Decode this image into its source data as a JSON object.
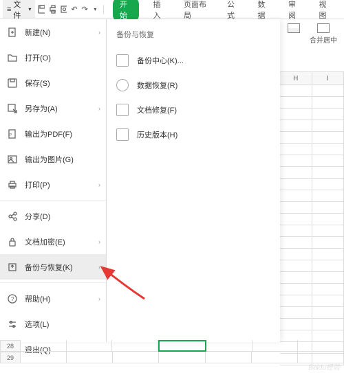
{
  "toolbar": {
    "file_label": "文件"
  },
  "tabs": {
    "start": "开始",
    "insert": "插入",
    "layout": "页面布局",
    "formula": "公式",
    "data": "数据",
    "review": "审阅",
    "view": "视图"
  },
  "ribbon": {
    "merge_center": "合并居中"
  },
  "file_menu": {
    "new": "新建(N)",
    "open": "打开(O)",
    "save": "保存(S)",
    "save_as": "另存为(A)",
    "export_pdf": "输出为PDF(F)",
    "export_img": "输出为图片(G)",
    "print": "打印(P)",
    "share": "分享(D)",
    "encrypt": "文档加密(E)",
    "backup": "备份与恢复(K)",
    "help": "帮助(H)",
    "options": "选项(L)",
    "exit": "退出(Q)"
  },
  "submenu": {
    "title": "备份与恢复",
    "items": {
      "backup_center": "备份中心(K)...",
      "data_recovery": "数据恢复(R)",
      "doc_repair": "文档修复(F)",
      "history": "历史版本(H)"
    }
  },
  "grid": {
    "col_h": "H",
    "col_i": "I",
    "row_28": "28",
    "row_29": "29"
  },
  "watermark": "Baidu经验"
}
